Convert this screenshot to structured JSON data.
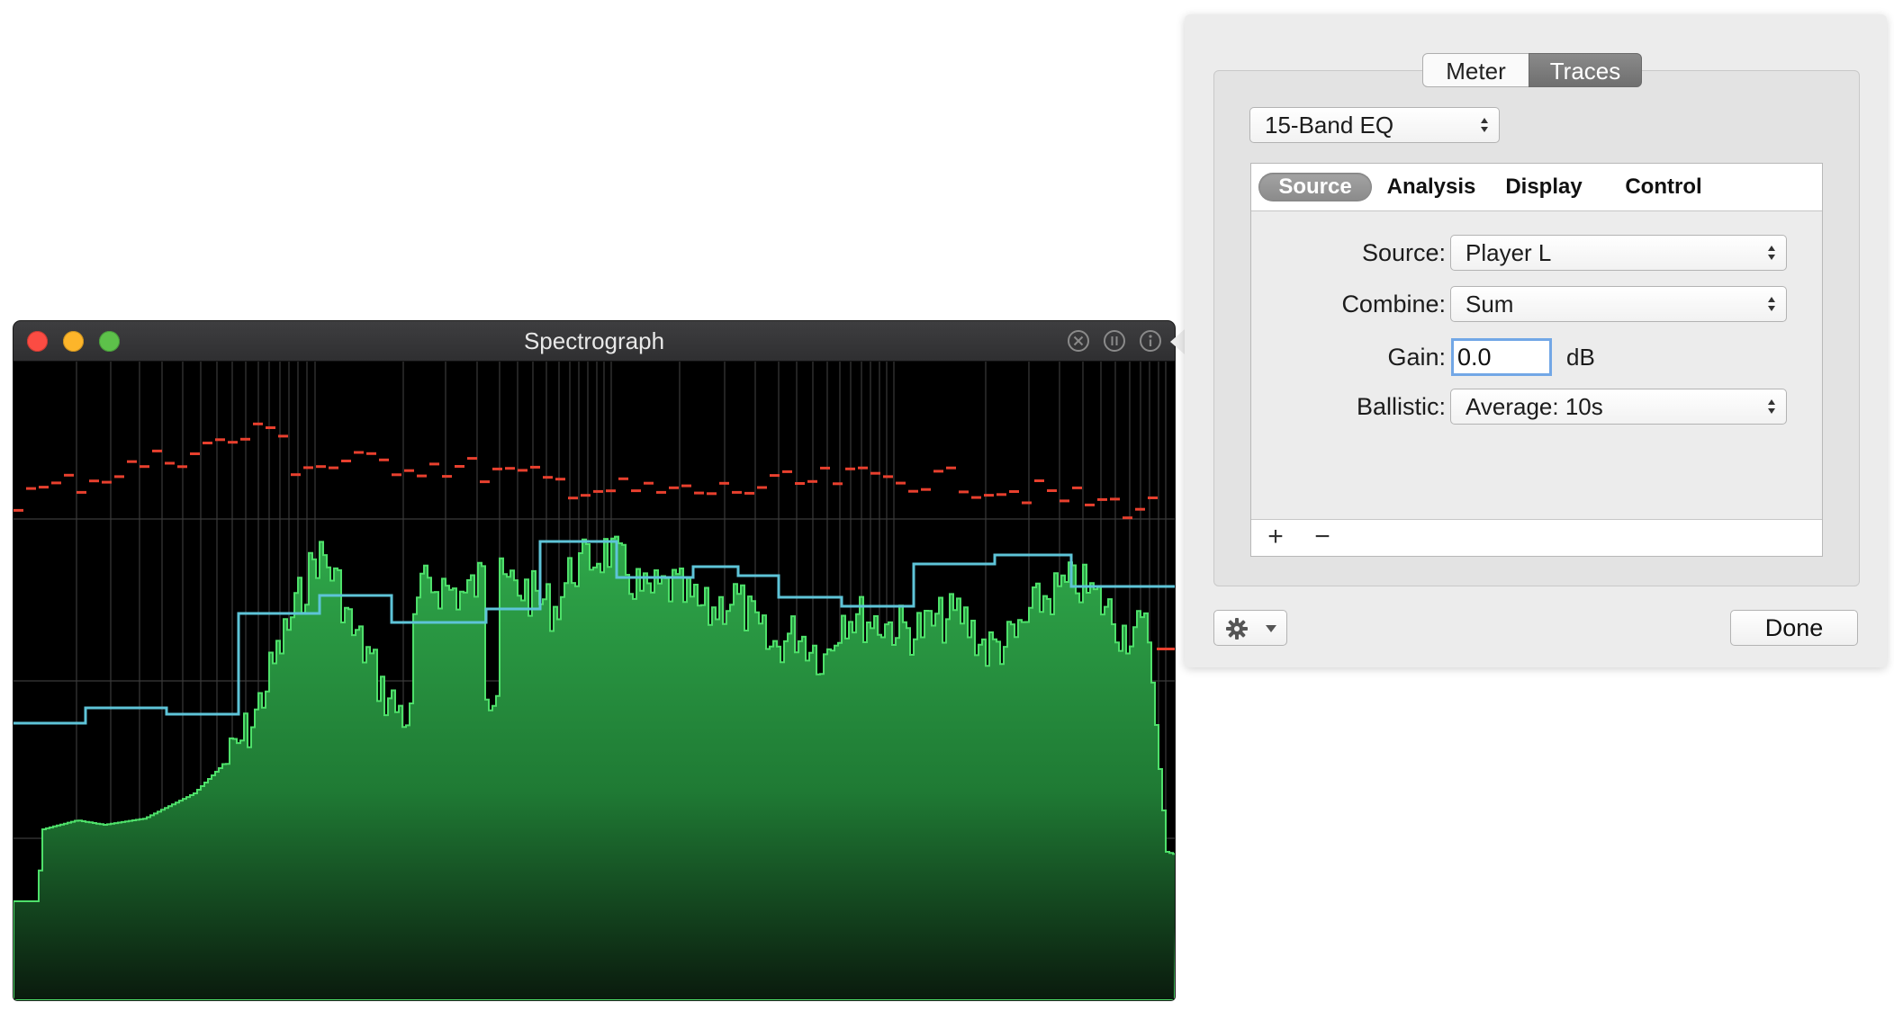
{
  "spectrograph": {
    "title": "Spectrograph"
  },
  "inspector": {
    "segments": [
      "Meter",
      "Traces"
    ],
    "selected_segment": "Traces",
    "preset": "15-Band EQ",
    "subtabs": [
      "Source",
      "Analysis",
      "Display",
      "Control"
    ],
    "selected_subtab": "Source",
    "fields": {
      "source_label": "Source:",
      "source_value": "Player L",
      "combine_label": "Combine:",
      "combine_value": "Sum",
      "gain_label": "Gain:",
      "gain_value": "0.0",
      "gain_unit": "dB",
      "ballistic_label": "Ballistic:",
      "ballistic_value": "Average: 10s"
    },
    "add_label": "+",
    "remove_label": "−",
    "done_label": "Done"
  },
  "colors": {
    "spectrum_fill": "#2fa84a",
    "spectrum_edge": "#4ee06a",
    "eq_trace": "#5ec4d8",
    "peak_trace": "#e8402e",
    "focus_ring": "#72a7e6"
  }
}
